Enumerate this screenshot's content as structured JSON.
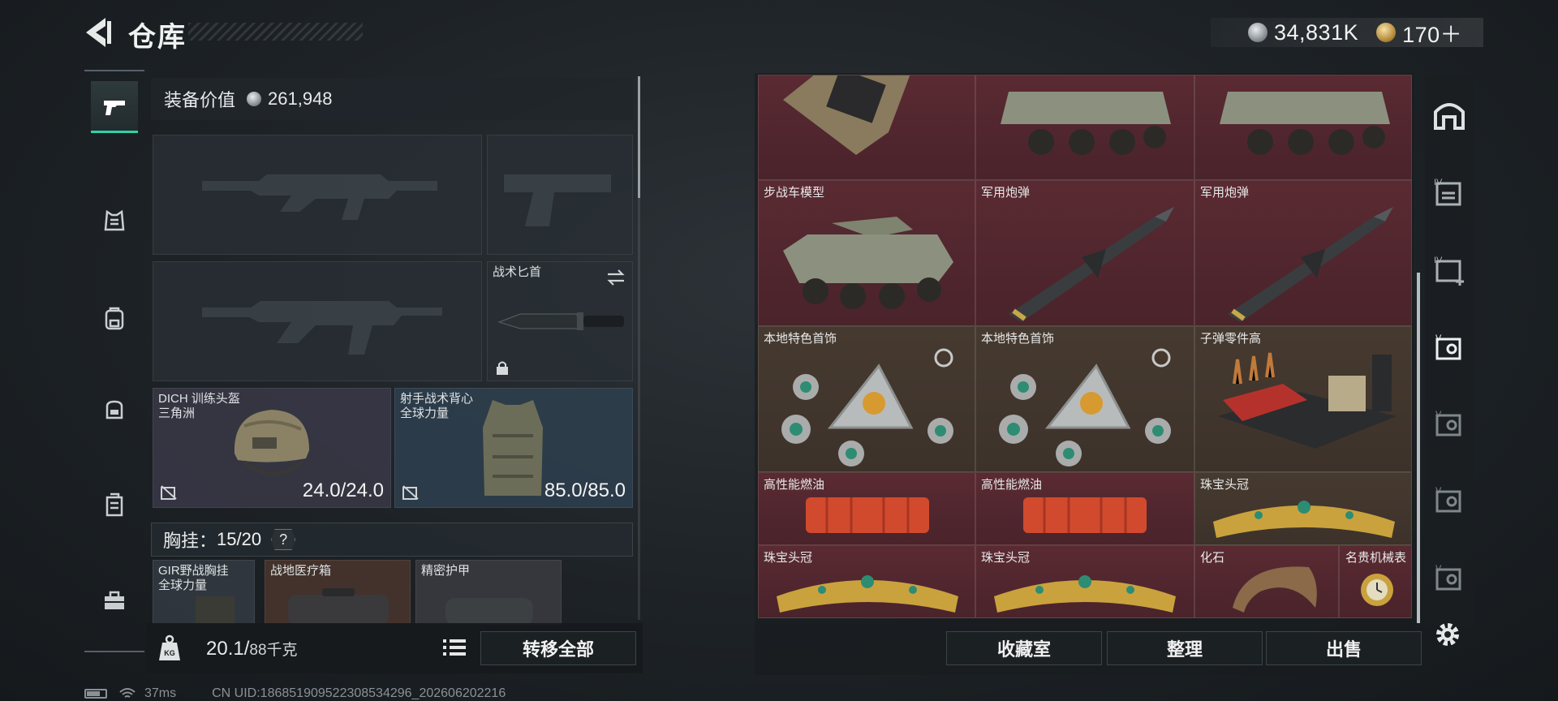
{
  "header": {
    "title": "仓库",
    "silver_amount": "34,831K",
    "gold_amount": "170＋"
  },
  "loadout": {
    "value_label": "装备价值",
    "value_amount": "261,948",
    "knife_label": "战术匕首",
    "helmet": {
      "name": "DICH 训练头盔",
      "source": "三角洲",
      "durability": "24.0/24.0"
    },
    "vest": {
      "name": "射手战术背心",
      "source": "全球力量",
      "durability": "85.0/85.0"
    },
    "chest_label": "胸挂：",
    "chest_count": "15/20",
    "chest_help": "?",
    "rig": {
      "name": "GIR野战胸挂",
      "source": "全球力量"
    },
    "medkit": "战地医疗箱",
    "armor": "精密护甲",
    "weight_current": "20.1/",
    "weight_max": "88千克",
    "transfer_all": "转移全部"
  },
  "status": {
    "ping": "37ms",
    "uid": "CN UID:1868519095223085342​96_202606202216"
  },
  "stash": {
    "items": [
      {
        "name": "步战车模型"
      },
      {
        "name": "军用炮弹"
      },
      {
        "name": "军用炮弹"
      },
      {
        "name": "本地特色首饰"
      },
      {
        "name": "本地特色首饰"
      },
      {
        "name": "子弹零件高"
      },
      {
        "name": "高性能燃油"
      },
      {
        "name": "高性能燃油"
      },
      {
        "name": "珠宝头冠"
      },
      {
        "name": "珠宝头冠"
      },
      {
        "name": "珠宝头冠"
      },
      {
        "name": "化石"
      },
      {
        "name": "名贵机械表"
      }
    ],
    "buttons": {
      "collection": "收藏室",
      "sort": "整理",
      "sell": "出售"
    }
  },
  "colors": {
    "accent": "#2fd2a8",
    "rare_red": "#5a2a32",
    "rare_gold": "#463a30"
  },
  "icons": {
    "rail": [
      "pistol-icon",
      "armor-icon",
      "backpack-icon",
      "bag-icon",
      "container-icon",
      "toolbox-icon"
    ],
    "tabs": [
      "home-icon",
      "stash-tab-icon",
      "stash-add-icon",
      "stash-v-icon",
      "gear-icon"
    ]
  }
}
